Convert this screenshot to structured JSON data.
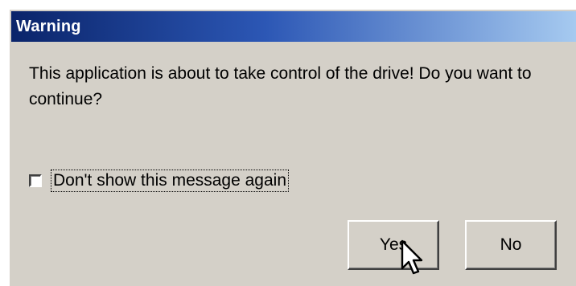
{
  "dialog": {
    "title": "Warning",
    "message": "This application is about to take control of the drive!  Do you want to continue?",
    "checkbox": {
      "label": "Don't show this message again",
      "checked": false
    },
    "buttons": {
      "yes": "Yes",
      "no": "No"
    }
  },
  "colors": {
    "titlebar_start": "#0a246a",
    "titlebar_end": "#a6caf0",
    "face": "#d4d0c8"
  },
  "icons": {
    "cursor": "arrow-cursor-icon"
  }
}
